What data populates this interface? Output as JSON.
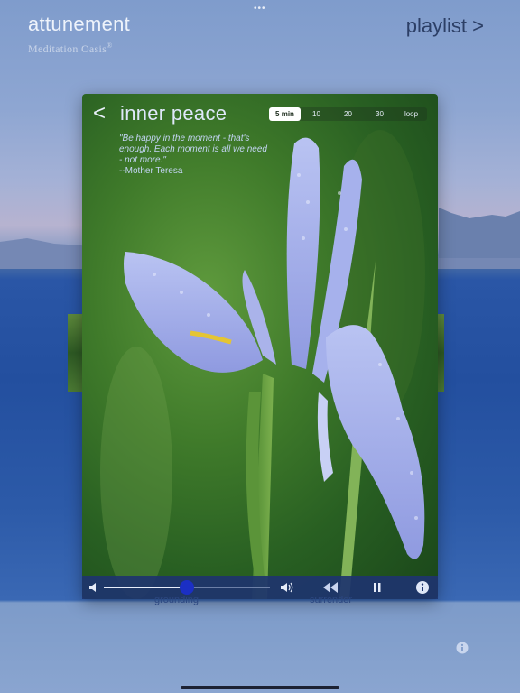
{
  "header": {
    "app_title": "attunement",
    "app_subtitle": "Meditation Oasis",
    "registered_mark": "®",
    "playlist_link": "playlist >",
    "top_dots": "•••"
  },
  "card": {
    "back_label": "<",
    "title": "inner peace",
    "durations": [
      "5 min",
      "10",
      "20",
      "30",
      "loop"
    ],
    "selected_duration": "5 min",
    "quote_text": "\"Be happy in the moment - that's enough. Each moment is all we need - not more.\"",
    "quote_author": "--Mother Teresa"
  },
  "controls": {
    "volume_level": 0.5,
    "track_labels": {
      "left": "grounding",
      "right": "surrender"
    }
  },
  "colors": {
    "accent_blue": "#1b2fc4",
    "control_bar": "#1e346e",
    "title_text": "#dfe8fa",
    "quote_text": "#c4d5f5"
  },
  "icons": {
    "volume_low": "speaker-low-icon",
    "volume_high": "speaker-high-icon",
    "rewind": "rewind-icon",
    "pause": "pause-icon",
    "info": "info-icon"
  }
}
